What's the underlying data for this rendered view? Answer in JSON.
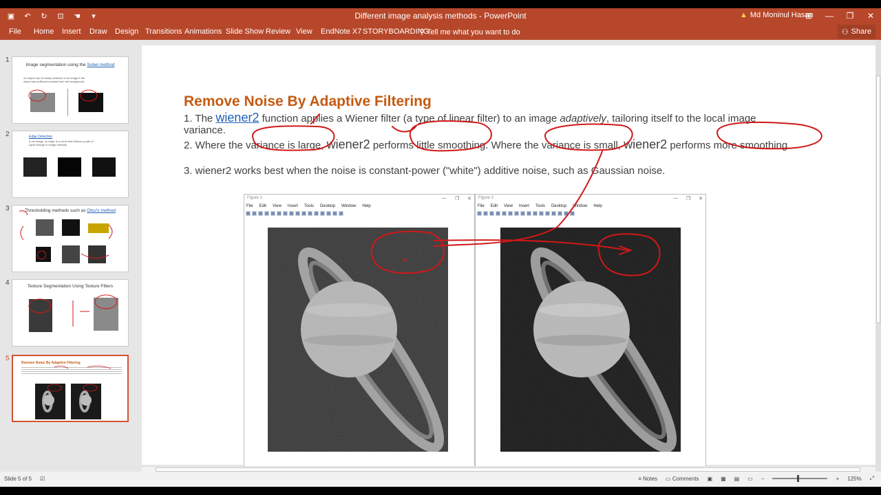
{
  "app": {
    "title": "Different image analysis methods - PowerPoint",
    "user": "Md Moninul Hasan",
    "share_label": "Share"
  },
  "colors": {
    "ribbon": "#b7472a",
    "title_text": "#c55a11",
    "link": "#1f5fb5",
    "ink": "#d01818"
  },
  "ribbon_tabs": [
    "File",
    "Home",
    "Insert",
    "Draw",
    "Design",
    "Transitions",
    "Animations",
    "Slide Show",
    "Review",
    "View",
    "EndNote X7",
    "STORYBOARDING",
    "Tell me what you want to do"
  ],
  "thumbnails": [
    {
      "number": "1",
      "title_pre": "Image segmentation using the ",
      "title_link": "Sobel method",
      "line1": "An object can be easily detected in an image if the",
      "line2": "object has sufficient contrast from the background."
    },
    {
      "number": "2",
      "title_pre": "",
      "title_link": "Edge Detection",
      "line1": "In an image, an edge is a curve that follows a path of",
      "line2": "rapid change in image intensity."
    },
    {
      "number": "3",
      "title_pre": "Thresholding methods such as ",
      "title_link": "Otsu's method",
      "line1": "",
      "line2": ""
    },
    {
      "number": "4",
      "title_pre": "Texture Segmentation Using Texture Filters",
      "title_link": "",
      "line1": "",
      "line2": ""
    },
    {
      "number": "5",
      "title_pre": "Remove Noise By Adaptive Filtering",
      "title_link": "",
      "line1": "",
      "line2": ""
    }
  ],
  "slide": {
    "title": "Remove Noise By Adaptive Filtering",
    "p1_a": "1. The ",
    "p1_link": "wiener2",
    "p1_b": " function applies a Wiener filter (a type of linear filter) to an image ",
    "p1_em": "adaptively",
    "p1_c": ", tailoring itself to the local image",
    "p1_d": "variance.",
    "p2_a": "2. Where the variance is large, ",
    "p2_w1": "wiener2",
    "p2_b": " performs little smoothing. Where the variance is small, ",
    "p2_w2": "wiener2",
    "p2_c": " performs more smoothing.",
    "p3": "3. wiener2 works best when the noise is constant-power (\"white\") additive noise, such as Gaussian noise."
  },
  "figures": [
    {
      "title": "Figure 1",
      "menu": [
        "File",
        "Edit",
        "View",
        "Insert",
        "Tools",
        "Desktop",
        "Window",
        "Help"
      ]
    },
    {
      "title": "Figure 2",
      "menu": [
        "File",
        "Edit",
        "View",
        "Insert",
        "Tools",
        "Desktop",
        "Window",
        "Help"
      ]
    }
  ],
  "status": {
    "slide_info": "Slide 5 of 5",
    "notes_label": "Notes",
    "comments_label": "Comments",
    "zoom": "125%"
  }
}
